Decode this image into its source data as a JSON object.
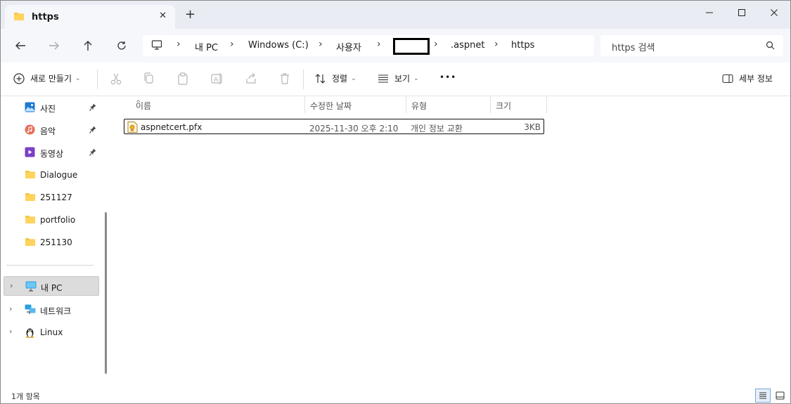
{
  "window": {
    "tab_title": "https",
    "tab_close": "✕",
    "new_tab": "+"
  },
  "address": {
    "crumbs": [
      "내 PC",
      "Windows (C:)",
      "사용자",
      ".aspnet",
      "https"
    ]
  },
  "search": {
    "placeholder": "https 검색"
  },
  "toolbar": {
    "new_label": "새로 만들기",
    "sort_label": "정렬",
    "view_label": "보기",
    "more_label": "•••",
    "details_label": "세부 정보"
  },
  "sidebar": {
    "items": [
      {
        "label": "사진",
        "icon": "photos-icon",
        "pinned": true
      },
      {
        "label": "음악",
        "icon": "music-icon",
        "pinned": true
      },
      {
        "label": "동영상",
        "icon": "video-icon",
        "pinned": true
      },
      {
        "label": "Dialogue",
        "icon": "folder-icon",
        "pinned": false
      },
      {
        "label": "251127",
        "icon": "folder-icon",
        "pinned": false
      },
      {
        "label": "portfolio",
        "icon": "folder-icon",
        "pinned": false
      },
      {
        "label": "251130",
        "icon": "folder-icon",
        "pinned": false
      }
    ],
    "nodes": [
      {
        "label": "내 PC",
        "icon": "pc-icon",
        "selected": true
      },
      {
        "label": "네트워크",
        "icon": "network-icon",
        "selected": false
      },
      {
        "label": "Linux",
        "icon": "linux-icon",
        "selected": false
      }
    ]
  },
  "columns": {
    "name": "이름",
    "modified": "수정한 날짜",
    "type": "유형",
    "size": "크기"
  },
  "files": [
    {
      "name": "aspnetcert.pfx",
      "modified": "2025-11-30 오후 2:10",
      "type": "개인 정보 교환",
      "size": "3KB"
    }
  ],
  "status": {
    "item_count": "1개 항목"
  },
  "colors": {
    "folder": "#F4C542",
    "accent": "#0067C0",
    "selected_bg": "#DCDCDC"
  }
}
